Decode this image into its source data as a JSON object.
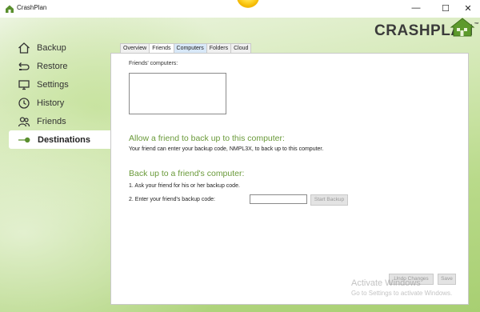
{
  "window": {
    "title": "CrashPlan",
    "minimize": "—",
    "maximize": "☐",
    "close": "✕"
  },
  "logo": {
    "text": "CRASHPLAN",
    "tm": "™"
  },
  "nav": [
    {
      "label": "Backup",
      "icon": "house-icon"
    },
    {
      "label": "Restore",
      "icon": "restore-icon"
    },
    {
      "label": "Settings",
      "icon": "monitor-icon"
    },
    {
      "label": "History",
      "icon": "clock-icon"
    },
    {
      "label": "Friends",
      "icon": "friends-icon"
    },
    {
      "label": "Destinations",
      "icon": "destinations-icon",
      "active": true
    }
  ],
  "tabs": [
    {
      "label": "Overview"
    },
    {
      "label": "Friends",
      "active": true
    },
    {
      "label": "Computers"
    },
    {
      "label": "Folders"
    },
    {
      "label": "Cloud"
    }
  ],
  "content": {
    "friends_computers_label": "Friends' computers:",
    "allow_heading": "Allow a friend to back up to this computer:",
    "allow_text": "Your friend can enter your backup code, NMPL3X, to back up to this computer.",
    "backup_heading": "Back up to a friend's computer:",
    "step1": "1. Ask your friend for his or her backup code.",
    "step2": "2. Enter your friend's backup code:",
    "code_value": "",
    "start_backup": "Start Backup",
    "undo_changes": "Undo Changes",
    "save": "Save"
  },
  "watermark": {
    "line1": "Activate Windows",
    "line2": "Go to Settings to activate Windows."
  },
  "colors": {
    "accent_green": "#6a9a3a",
    "nav_bg": "#c8e3a0"
  }
}
